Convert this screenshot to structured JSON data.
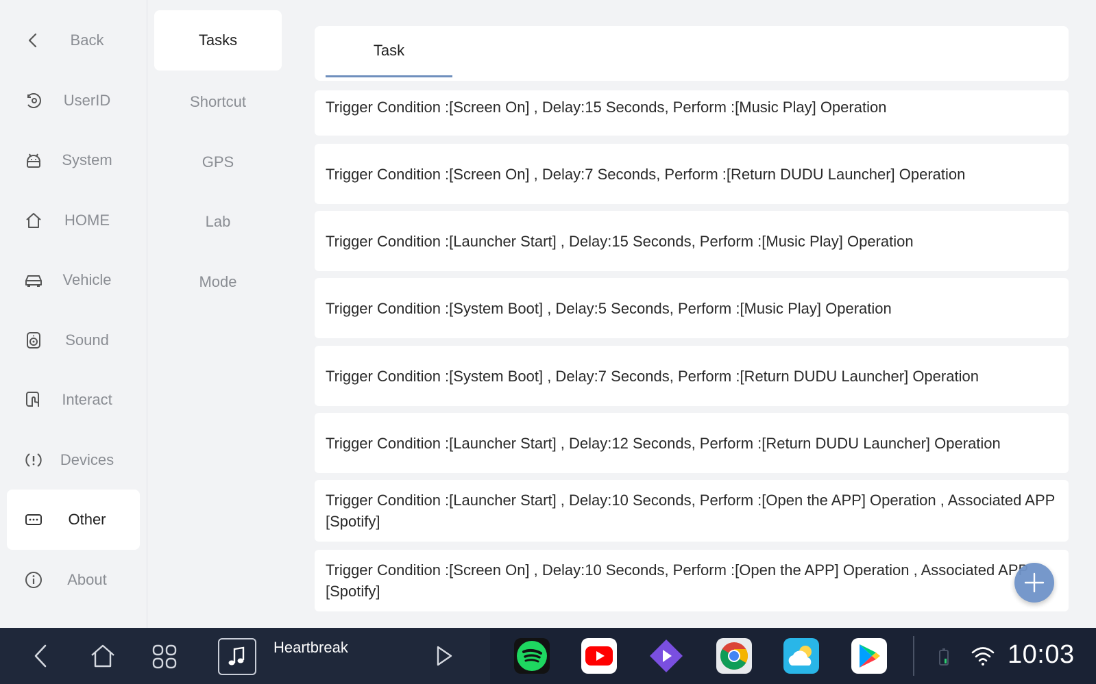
{
  "sidebar": {
    "items": [
      {
        "label": "Back",
        "icon": "chevron-left-icon"
      },
      {
        "label": "UserID",
        "icon": "userid-icon"
      },
      {
        "label": "System",
        "icon": "android-icon"
      },
      {
        "label": "HOME",
        "icon": "home-icon"
      },
      {
        "label": "Vehicle",
        "icon": "car-icon"
      },
      {
        "label": "Sound",
        "icon": "speaker-icon"
      },
      {
        "label": "Interact",
        "icon": "touch-icon"
      },
      {
        "label": "Devices",
        "icon": "alert-icon"
      },
      {
        "label": "Other",
        "icon": "more-icon",
        "active": true
      },
      {
        "label": "About",
        "icon": "info-icon"
      }
    ]
  },
  "subnav": {
    "items": [
      {
        "label": "Tasks",
        "active": true
      },
      {
        "label": "Shortcut"
      },
      {
        "label": "GPS"
      },
      {
        "label": "Lab"
      },
      {
        "label": "Mode"
      }
    ]
  },
  "main": {
    "tab_label": "Task",
    "tasks": [
      "Trigger Condition :[Screen On] , Delay:15 Seconds, Perform :[Music Play] Operation",
      "Trigger Condition :[Screen On] , Delay:7 Seconds, Perform :[Return DUDU Launcher] Operation",
      "Trigger Condition :[Launcher Start] , Delay:15 Seconds, Perform :[Music Play] Operation",
      "Trigger Condition :[System Boot] , Delay:5 Seconds, Perform :[Music Play] Operation",
      "Trigger Condition :[System Boot] , Delay:7 Seconds, Perform :[Return DUDU Launcher] Operation",
      "Trigger Condition :[Launcher Start] , Delay:12 Seconds, Perform :[Return DUDU Launcher] Operation",
      "Trigger Condition :[Launcher Start] , Delay:10 Seconds, Perform :[Open the APP] Operation , Associated APP [Spotify]",
      "Trigger Condition :[Screen On] , Delay:10 Seconds, Perform :[Open the APP] Operation , Associated APP [Spotify]"
    ],
    "fab_icon": "plus-icon"
  },
  "dock": {
    "track_title": "Heartbreak",
    "clock": "10:03",
    "apps": [
      "Spotify",
      "YouTube",
      "Prime Video",
      "Chrome",
      "Weather",
      "Google Play"
    ]
  },
  "colors": {
    "accent": "#6f8fbd",
    "fab": "#6f93c9",
    "dock_bg": "#1a2234",
    "page_bg": "#f2f3f5"
  }
}
